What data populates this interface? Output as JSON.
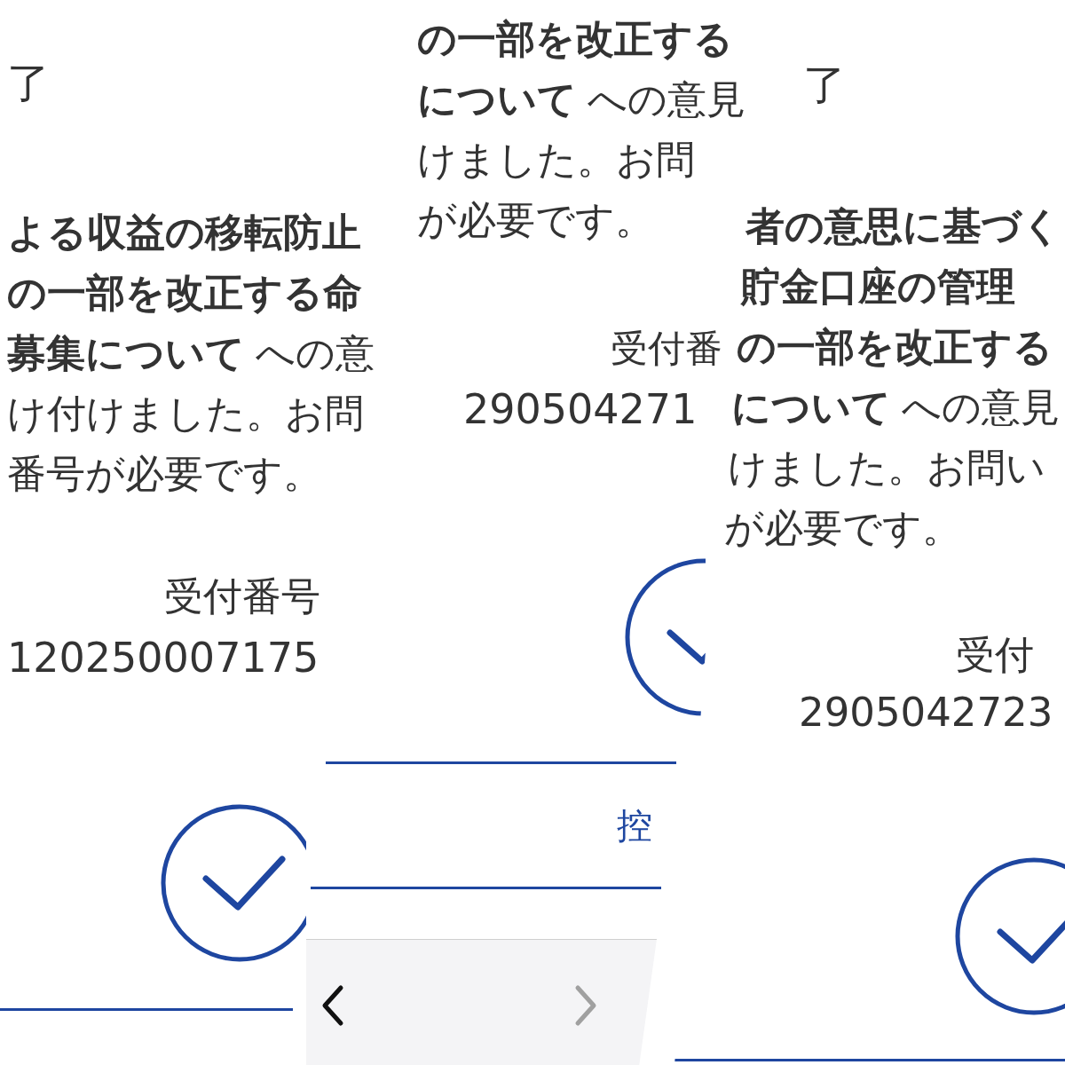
{
  "fragments": [
    {
      "title": "了",
      "heading_lines": [
        "よる収益の移転防止",
        "の一部を改正する命"
      ],
      "topic_line": "**募集について** への意",
      "message_lines": [
        "け付けました。お問",
        "番号が必要です。"
      ],
      "receipt_label": "受付番号",
      "receipt_number": "120250007175"
    },
    {
      "heading_lines": [
        "の一部を改正する"
      ],
      "topic_line": "**について** への意見",
      "message_lines": [
        "けました。お問",
        "が必要です。"
      ],
      "receipt_label": "受付番",
      "receipt_number": "290504271",
      "copy_link": "控",
      "toolbar": {
        "back_enabled": true,
        "forward_enabled": false
      }
    },
    {
      "title": "了",
      "heading_lines": [
        "者の意思に基づく",
        "貯金口座の管理",
        "の一部を改正する"
      ],
      "topic_line": "**について** への意見",
      "message_lines": [
        "けました。お問い",
        "が必要です。"
      ],
      "receipt_label": "受付",
      "receipt_number": "2905042723"
    }
  ]
}
